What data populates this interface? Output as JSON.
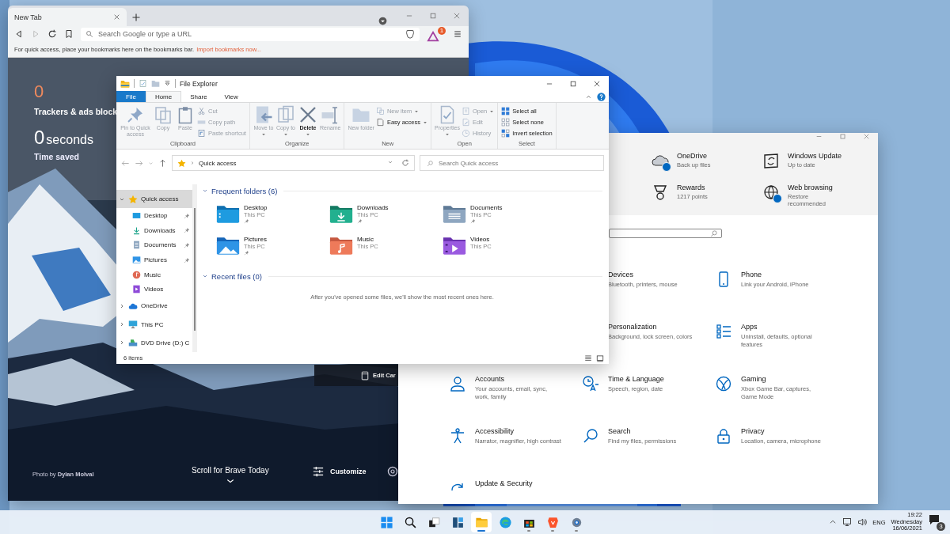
{
  "browser": {
    "tab": {
      "title": "New Tab",
      "selected": true
    },
    "address": {
      "placeholder": "Search Google or type a URL"
    },
    "rewards_badge": "1",
    "bookmarks_bar": {
      "hint": "For quick access, place your bookmarks here on the bookmarks bar.",
      "link": "Import bookmarks now..."
    },
    "trackers": {
      "count": "0",
      "label": "Trackers & ads block"
    },
    "time_saved": {
      "value": "0",
      "unit": "seconds",
      "label": "Time saved"
    },
    "photo_credit": "Photo by **Dylan Molval**",
    "scroll_hint": "Scroll for Brave Today",
    "customize": "Customize",
    "edit_cards": "Edit Car"
  },
  "settings": {
    "quick_status": [
      {
        "title": "OneDrive",
        "detail": "Back up files",
        "badge": true
      },
      {
        "title": "Windows Update",
        "detail": "Up to date",
        "badge": false
      },
      {
        "title": "Rewards",
        "detail": "1217 points",
        "badge": false
      },
      {
        "title": "Web browsing",
        "detail": "Restore recommended",
        "badge": true
      }
    ],
    "categories": [
      {
        "title": "Devices",
        "detail": "Bluetooth, printers, mouse"
      },
      {
        "title": "Phone",
        "detail": "Link your Android, iPhone"
      },
      {
        "title": "Personalization",
        "detail": "Background, lock screen, colors"
      },
      {
        "title": "Apps",
        "detail": "Uninstall, defaults, optional features"
      },
      {
        "title": "Accounts",
        "detail": "Your accounts, email, sync, work, family"
      },
      {
        "title": "Time & Language",
        "detail": "Speech, region, date"
      },
      {
        "title": "Gaming",
        "detail": "Xbox Game Bar, captures, Game Mode"
      },
      {
        "title": "Accessibility",
        "detail": "Narrator, magnifier, high contrast"
      },
      {
        "title": "Search",
        "detail": "Find my files, permissions"
      },
      {
        "title": "Privacy",
        "detail": "Location, camera, microphone"
      },
      {
        "title": "Update & Security"
      }
    ]
  },
  "explorer": {
    "title": "File Explorer",
    "ribbon_tabs": [
      {
        "label": "File",
        "kind": "file",
        "selected": false
      },
      {
        "label": "Home",
        "kind": "tab",
        "selected": true
      },
      {
        "label": "Share",
        "kind": "tab",
        "selected": false
      },
      {
        "label": "View",
        "kind": "tab",
        "selected": false
      }
    ],
    "ribbon_groups": [
      {
        "label": "Clipboard",
        "commands": [
          {
            "label": "Pin to Quick access",
            "kind": "large",
            "disabled": true,
            "dropdown": false
          },
          {
            "label": "Copy",
            "kind": "large",
            "disabled": true,
            "dropdown": false
          },
          {
            "label": "Paste",
            "kind": "large",
            "disabled": true,
            "dropdown": false
          },
          {
            "label": "Cut",
            "kind": "small",
            "disabled": true,
            "dropdown": false
          },
          {
            "label": "Copy path",
            "kind": "small",
            "disabled": true,
            "dropdown": false
          },
          {
            "label": "Paste shortcut",
            "kind": "small",
            "disabled": true,
            "dropdown": false
          }
        ]
      },
      {
        "label": "Organize",
        "commands": [
          {
            "label": "Move to",
            "kind": "large",
            "disabled": true,
            "dropdown": true
          },
          {
            "label": "Copy to",
            "kind": "large",
            "disabled": true,
            "dropdown": true
          },
          {
            "label": "Delete",
            "kind": "large",
            "disabled": false,
            "dropdown": true
          },
          {
            "label": "Rename",
            "kind": "large",
            "disabled": true,
            "dropdown": false
          }
        ]
      },
      {
        "label": "New",
        "commands": [
          {
            "label": "New folder",
            "kind": "large",
            "disabled": true,
            "dropdown": false
          },
          {
            "label": "New item",
            "kind": "small",
            "disabled": true,
            "dropdown": true
          },
          {
            "label": "Easy access",
            "kind": "small",
            "disabled": false,
            "dropdown": true
          }
        ]
      },
      {
        "label": "Open",
        "commands": [
          {
            "label": "Properties",
            "kind": "large",
            "disabled": true,
            "dropdown": true
          },
          {
            "label": "Open",
            "kind": "small",
            "disabled": true,
            "dropdown": true
          },
          {
            "label": "Edit",
            "kind": "small",
            "disabled": true,
            "dropdown": false
          },
          {
            "label": "History",
            "kind": "small",
            "disabled": true,
            "dropdown": false
          }
        ]
      },
      {
        "label": "Select",
        "commands": [
          {
            "label": "Select all",
            "kind": "small",
            "disabled": false,
            "dropdown": false
          },
          {
            "label": "Select none",
            "kind": "small",
            "disabled": false,
            "dropdown": false
          },
          {
            "label": "Invert selection",
            "kind": "small",
            "disabled": false,
            "dropdown": false
          }
        ]
      }
    ],
    "address": "Quick access",
    "search": {
      "placeholder": "Search Quick access"
    },
    "navigation": [
      {
        "label": "Quick access",
        "expanded": true,
        "selected": true,
        "children": [
          {
            "label": "Desktop",
            "pinned": true,
            "selected": false
          },
          {
            "label": "Downloads",
            "pinned": true,
            "selected": false
          },
          {
            "label": "Documents",
            "pinned": true,
            "selected": false
          },
          {
            "label": "Pictures",
            "pinned": true,
            "selected": false
          },
          {
            "label": "Music",
            "pinned": false,
            "selected": false
          },
          {
            "label": "Videos",
            "pinned": false,
            "selected": false
          }
        ]
      },
      {
        "label": "OneDrive",
        "expanded": false,
        "selected": false
      },
      {
        "label": "This PC",
        "expanded": false,
        "selected": false
      },
      {
        "label": "DVD Drive (D:) C",
        "expanded": false,
        "selected": false
      }
    ],
    "sections": [
      {
        "title": "Frequent folders (6)",
        "expanded": true,
        "items": [
          {
            "name": "Desktop",
            "location": "This PC",
            "pinned": true
          },
          {
            "name": "Downloads",
            "location": "This PC",
            "pinned": true
          },
          {
            "name": "Documents",
            "location": "This PC",
            "pinned": true
          },
          {
            "name": "Pictures",
            "location": "This PC",
            "pinned": true
          },
          {
            "name": "Music",
            "location": "This PC",
            "pinned": false
          },
          {
            "name": "Videos",
            "location": "This PC",
            "pinned": false
          }
        ]
      },
      {
        "title": "Recent files (0)",
        "expanded": true,
        "empty_message": "After you've opened some files, we'll show the most recent ones here."
      }
    ],
    "status": "6 items"
  },
  "taskbar": {
    "apps": [
      {
        "running": false,
        "selected": false
      },
      {
        "running": false,
        "selected": false
      },
      {
        "running": false,
        "selected": false
      },
      {
        "running": false,
        "selected": false
      },
      {
        "running": true,
        "selected": true
      },
      {
        "running": false,
        "selected": false
      },
      {
        "running": true,
        "selected": false
      },
      {
        "running": true,
        "selected": false
      },
      {
        "running": true,
        "selected": false
      }
    ],
    "language": "ENG",
    "time": "19:22",
    "day": "Wednesday",
    "date": "16/06/2021",
    "notifications": "3"
  }
}
